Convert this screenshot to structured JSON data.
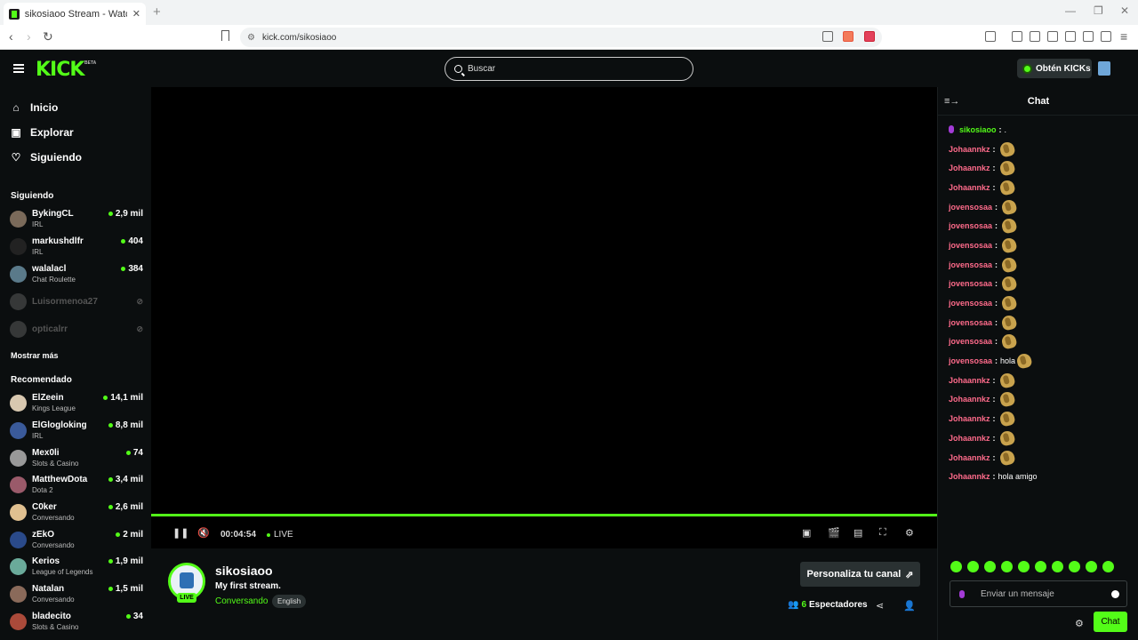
{
  "browser": {
    "tab_title": "sikosiaoo Stream - Watch Live on",
    "tab_close": "✕",
    "new_tab": "+",
    "url": "kick.com/sikosiaoo"
  },
  "header": {
    "logo": "KICK",
    "beta": "BETA",
    "search_placeholder": "Buscar",
    "get_kicks": "Obtén KICKs"
  },
  "sidebar": {
    "nav": [
      {
        "label": "Inicio",
        "icon": "home-icon"
      },
      {
        "label": "Explorar",
        "icon": "explore-icon"
      },
      {
        "label": "Siguiendo",
        "icon": "heart-icon"
      }
    ],
    "following_title": "Siguiendo",
    "following": [
      {
        "name": "BykingCL",
        "category": "IRL",
        "viewers": "2,9 mil",
        "avatar_color": "#7a6a5a"
      },
      {
        "name": "markushdlfr",
        "category": "IRL",
        "viewers": "404",
        "avatar_color": "#222222"
      },
      {
        "name": "walalacl",
        "category": "Chat Roulette",
        "viewers": "384",
        "avatar_color": "#5a7a8a"
      },
      {
        "name": "Luisormenoa27",
        "category": "",
        "viewers": "",
        "avatar_color": "#888888"
      },
      {
        "name": "opticalrr",
        "category": "",
        "viewers": "",
        "avatar_color": "#888888"
      }
    ],
    "show_more": "Mostrar más",
    "recommended_title": "Recomendado",
    "recommended": [
      {
        "name": "ElZeein",
        "category": "Kings League",
        "viewers": "14,1 mil",
        "avatar_color": "#d8c8b0"
      },
      {
        "name": "ElGlogloking",
        "category": "IRL",
        "viewers": "8,8 mil",
        "avatar_color": "#3a5a9a"
      },
      {
        "name": "Mex0li",
        "category": "Slots & Casino",
        "viewers": "74",
        "avatar_color": "#999999"
      },
      {
        "name": "MatthewDota",
        "category": "Dota 2",
        "viewers": "3,4 mil",
        "avatar_color": "#9a5a6a"
      },
      {
        "name": "C0ker",
        "category": "Conversando",
        "viewers": "2,6 mil",
        "avatar_color": "#e0c090"
      },
      {
        "name": "zEkO",
        "category": "Conversando",
        "viewers": "2 mil",
        "avatar_color": "#2a4a8a"
      },
      {
        "name": "Kerios",
        "category": "League of Legends",
        "viewers": "1,9 mil",
        "avatar_color": "#6aaa9a"
      },
      {
        "name": "Natalan",
        "category": "Conversando",
        "viewers": "1,5 mil",
        "avatar_color": "#8a6a5a"
      },
      {
        "name": "bladecito",
        "category": "Slots & Casino",
        "viewers": "34",
        "avatar_color": "#aa4a3a"
      }
    ]
  },
  "player": {
    "time": "00:04:54",
    "live": "LIVE"
  },
  "stream": {
    "streamer": "sikosiaoo",
    "live_badge": "LIVE",
    "title": "My first stream.",
    "category": "Conversando",
    "tag": "English",
    "customize": "Personaliza tu canal",
    "viewers_count": "6",
    "viewers_label": "Espectadores"
  },
  "chat": {
    "title": "Chat",
    "messages": [
      {
        "user": "sikosiaoo",
        "color": "#53fc18",
        "text": ".",
        "emote": false,
        "mic": true
      },
      {
        "user": "Johaannkz",
        "color": "#ff6b8b",
        "text": "",
        "emote": true
      },
      {
        "user": "Johaannkz",
        "color": "#ff6b8b",
        "text": "",
        "emote": true
      },
      {
        "user": "Johaannkz",
        "color": "#ff6b8b",
        "text": "",
        "emote": true
      },
      {
        "user": "jovensosaa",
        "color": "#ff6b8b",
        "text": "",
        "emote": true
      },
      {
        "user": "jovensosaa",
        "color": "#ff6b8b",
        "text": "",
        "emote": true
      },
      {
        "user": "jovensosaa",
        "color": "#ff6b8b",
        "text": "",
        "emote": true
      },
      {
        "user": "jovensosaa",
        "color": "#ff6b8b",
        "text": "",
        "emote": true
      },
      {
        "user": "jovensosaa",
        "color": "#ff6b8b",
        "text": "",
        "emote": true
      },
      {
        "user": "jovensosaa",
        "color": "#ff6b8b",
        "text": "",
        "emote": true
      },
      {
        "user": "jovensosaa",
        "color": "#ff6b8b",
        "text": "",
        "emote": true
      },
      {
        "user": "jovensosaa",
        "color": "#ff6b8b",
        "text": "",
        "emote": true
      },
      {
        "user": "jovensosaa",
        "color": "#ff6b8b",
        "text": "hola",
        "emote": true
      },
      {
        "user": "Johaannkz",
        "color": "#ff6b8b",
        "text": "",
        "emote": true
      },
      {
        "user": "Johaannkz",
        "color": "#ff6b8b",
        "text": "",
        "emote": true
      },
      {
        "user": "Johaannkz",
        "color": "#ff6b8b",
        "text": "",
        "emote": true
      },
      {
        "user": "Johaannkz",
        "color": "#ff6b8b",
        "text": "",
        "emote": true
      },
      {
        "user": "Johaannkz",
        "color": "#ff6b8b",
        "text": "",
        "emote": true
      },
      {
        "user": "Johaannkz",
        "color": "#ff6b8b",
        "text": "hola amigo",
        "emote": false
      }
    ],
    "input_placeholder": "Enviar un mensaje",
    "send_label": "Chat"
  },
  "colors": {
    "accent": "#53fc18",
    "background": "#0b0e0f"
  }
}
